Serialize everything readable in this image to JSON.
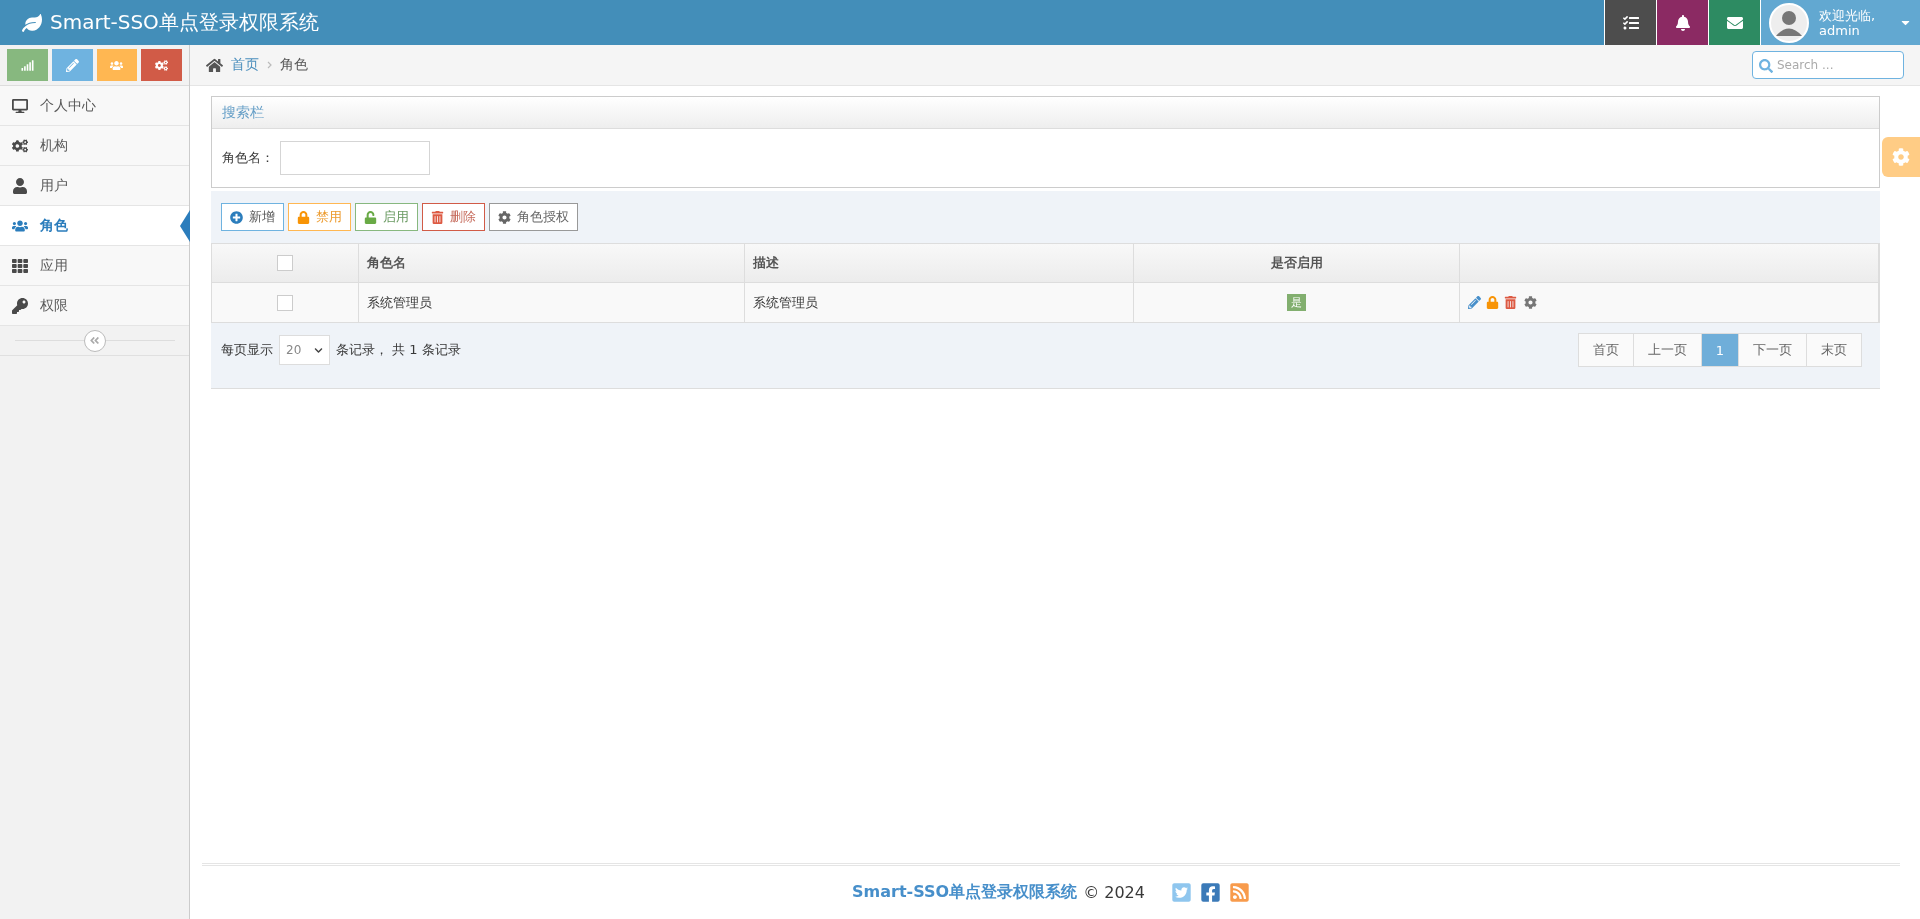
{
  "header": {
    "title": "Smart-SSO单点登录权限系统",
    "buttons": [
      {
        "color": "#4d4d4d"
      },
      {
        "color": "#8b2a63"
      },
      {
        "color": "#2d8b62"
      }
    ],
    "user": {
      "greeting": "欢迎光临,",
      "name": "admin"
    }
  },
  "shortcuts": [
    {
      "color": "#87b87f"
    },
    {
      "color": "#6fb3e0"
    },
    {
      "color": "#ffb752"
    },
    {
      "color": "#d15b47"
    }
  ],
  "sidebar": {
    "items": [
      {
        "label": "个人中心",
        "selected": false
      },
      {
        "label": "机构",
        "selected": false
      },
      {
        "label": "用户",
        "selected": false
      },
      {
        "label": "角色",
        "selected": true
      },
      {
        "label": "应用",
        "selected": false
      },
      {
        "label": "权限",
        "selected": false
      }
    ]
  },
  "breadcrumb": [
    "首页",
    "角色"
  ],
  "search": {
    "placeholder": "Search ..."
  },
  "search_panel": {
    "title": "搜索栏",
    "field_label": "角色名："
  },
  "toolbar": [
    {
      "kind": "add",
      "label": "新增"
    },
    {
      "kind": "disable",
      "label": "禁用"
    },
    {
      "kind": "enable",
      "label": "启用"
    },
    {
      "kind": "delete",
      "label": "删除"
    },
    {
      "kind": "grant",
      "label": "角色授权"
    }
  ],
  "table": {
    "header_checked": false,
    "columns": [
      "角色名",
      "描述",
      "是否启用"
    ],
    "rows": [
      {
        "checked": false,
        "name": "系统管理员",
        "description": "系统管理员",
        "enabled": "是"
      }
    ]
  },
  "pager": {
    "per_page_label": "每页显示",
    "per_page": "20",
    "summary": "条记录， 共 1 条记录",
    "pages": [
      {
        "label": "首页",
        "selected": false
      },
      {
        "label": "上一页",
        "selected": false
      },
      {
        "label": "1",
        "selected": true
      },
      {
        "label": "下一页",
        "selected": false
      },
      {
        "label": "末页",
        "selected": false
      }
    ]
  },
  "footer": {
    "brand": "Smart-SSO单点登录权限系统",
    "copyright": "© 2024"
  }
}
